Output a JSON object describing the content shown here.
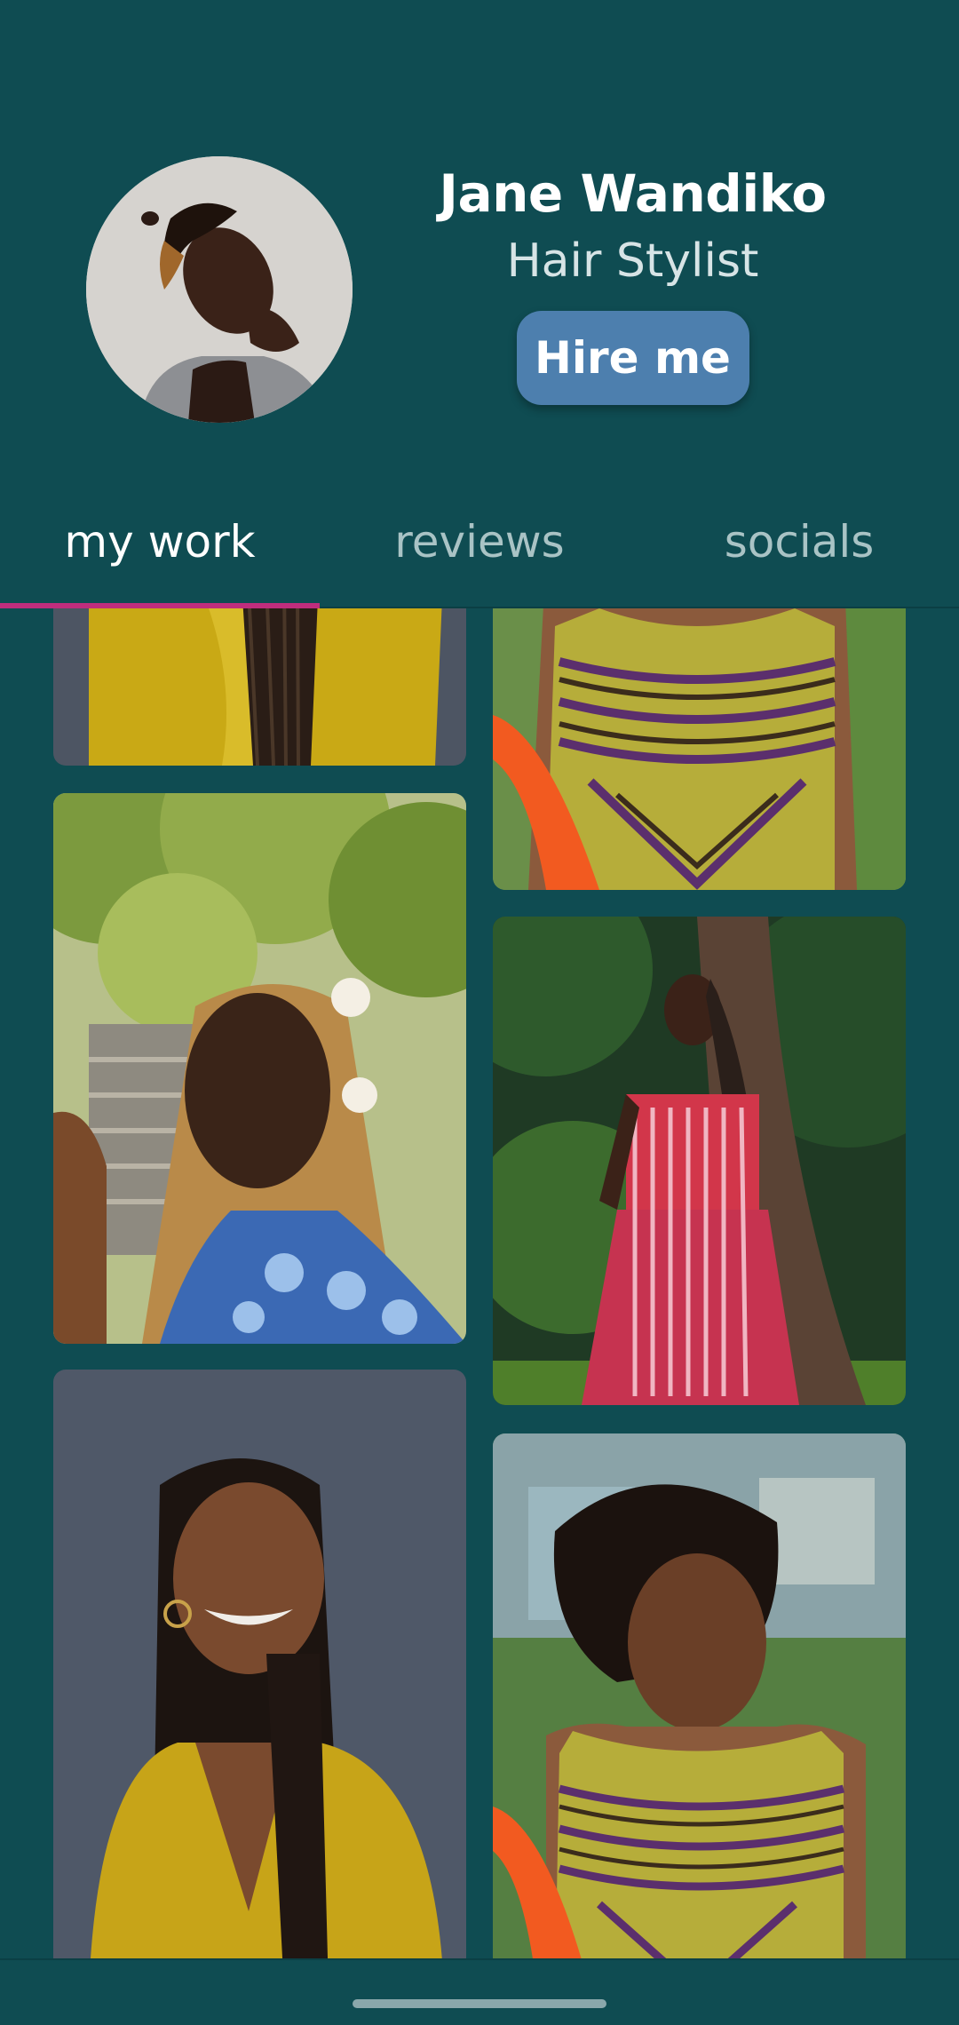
{
  "profile": {
    "name": "Jane Wandiko",
    "role": "Hair Stylist",
    "hire_label": "Hire me"
  },
  "tabs": [
    {
      "label": "my work",
      "active": true
    },
    {
      "label": "reviews",
      "active": false
    },
    {
      "label": "socials",
      "active": false
    }
  ],
  "colors": {
    "background": "#0f4c52",
    "accent_indicator": "#c02d7d",
    "button": "#4d7fae"
  },
  "gallery": {
    "photos": [
      {
        "name": "yellow-blouse-braids-photo"
      },
      {
        "name": "patterned-dress-photo"
      },
      {
        "name": "blonde-braids-flowers-photo"
      },
      {
        "name": "red-dress-tree-photo"
      },
      {
        "name": "smiling-braids-yellow-photo"
      },
      {
        "name": "curly-hair-patterned-dress-photo"
      }
    ]
  }
}
